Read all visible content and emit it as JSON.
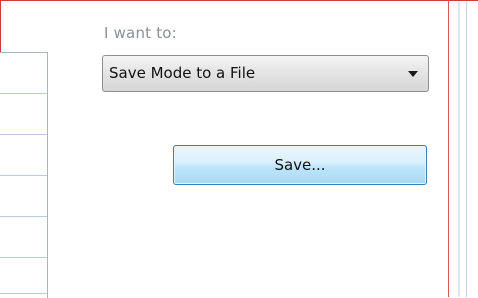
{
  "panel": {
    "intent_label": "I want to:",
    "mode_select": {
      "selected": "Save Mode to a File"
    },
    "save_button_label": "Save..."
  },
  "colors": {
    "frame_border": "#cc3b3b",
    "button_border": "#3c7fb1",
    "label_text": "#8a8f96"
  },
  "icons": {
    "dropdown_arrow": "chevron-down-icon"
  }
}
